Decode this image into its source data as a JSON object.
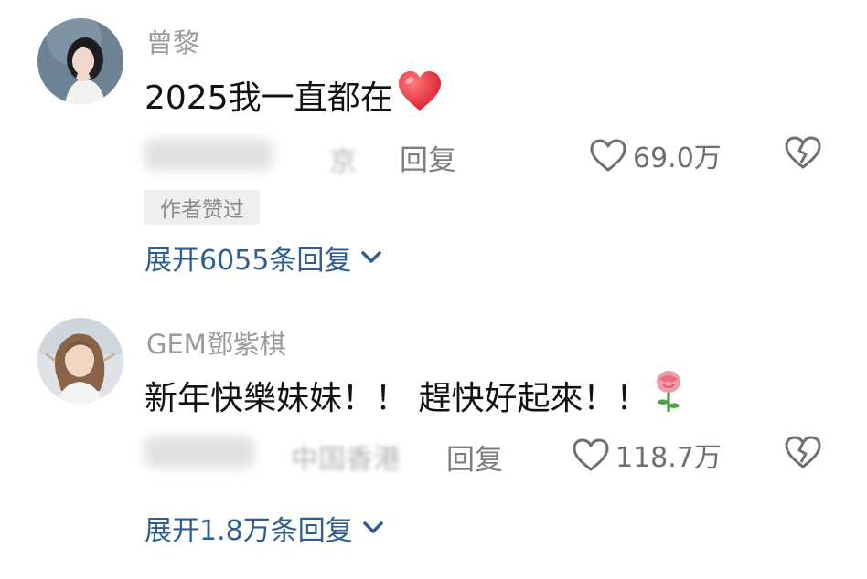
{
  "comments": [
    {
      "username": "曾黎",
      "text": "2025我一直都在",
      "emoji": "red-heart-emoji",
      "location": "京",
      "reply_label": "回复",
      "likes": "69.0万",
      "author_badge": "作者赞过",
      "expand_label": "展开6055条回复"
    },
    {
      "username": "GEM鄧紫棋",
      "text": "新年快樂妹妹！！ 趕快好起來！！",
      "emoji": "rose-emoji",
      "location": "中国香港",
      "reply_label": "回复",
      "likes": "118.7万",
      "expand_label": "展开1.8万条回复"
    }
  ],
  "icons": {
    "like": "heart-outline-icon",
    "dislike": "broken-heart-icon",
    "expand": "chevron-down-icon"
  },
  "colors": {
    "link": "#2f5d8f",
    "meta": "#7d7d7d",
    "username": "#9a9a9a",
    "heart": "#e53a48"
  }
}
